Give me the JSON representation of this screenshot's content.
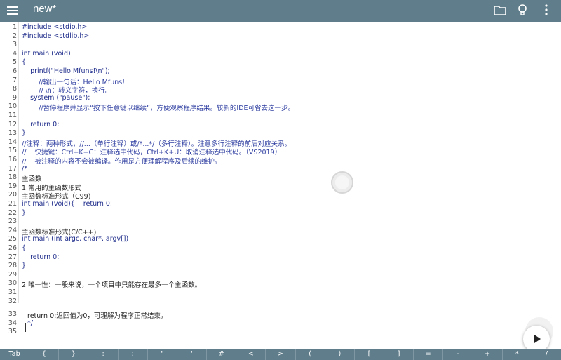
{
  "appbar": {
    "title": "new*",
    "icons": [
      "menu-icon",
      "folder-icon",
      "lightbulb-icon",
      "more-vert-icon"
    ]
  },
  "editor": {
    "line_numbers": [
      "1",
      "2",
      "3",
      "4",
      "5",
      "6",
      "7",
      "8",
      "9",
      "10",
      "11",
      "12",
      "13",
      "14",
      "15",
      "16",
      "17",
      "18",
      "19",
      "20",
      "21",
      "22",
      "23",
      "24",
      "25",
      "26",
      "27",
      "28",
      "29",
      "30",
      "31",
      "32",
      "33",
      "34",
      "35"
    ],
    "lines": [
      "#include <stdio.h>",
      "#include <stdlib.h>",
      "",
      "int main (void)",
      "{",
      "    printf(\"Hello Mfuns!\\n\");",
      "        //输出一句话：Hello Mfuns!",
      "        // \\n：转义字符，换行。",
      "    system (\"pause\");",
      "        //暂停程序并显示“按下任意键以继续”，方便观察程序结果。较新的IDE可省去这一步。",
      "",
      "    return 0;",
      "}",
      "//注释：两种形式，//...（单行注释）或/*...*/（多行注释）。注意多行注释的前后对应关系。",
      "//    快捷键：Ctrl+K+C：注释选中代码，Ctrl+K+U：取消注释选中代码。（VS2019）",
      "//    被注释的内容不会被编译。作用是方便理解程序及后续的维护。",
      "/*",
      "主函数",
      "1.常用的主函数形式",
      "主函数标准形式（C99)",
      "int main (void){    return 0;",
      "}",
      "",
      "主函数标准形式(C/C++)",
      "int main (int argc, char*, argv[])",
      "{",
      "    return 0;",
      "}",
      "",
      "2.唯一性：一般来说，一个项目中只能存在最多一个主函数。",
      "",
      "",
      " return 0:返回值为0，可理解为程序正常结束。",
      " */",
      ""
    ]
  },
  "keybar": {
    "keys": [
      "Tab",
      "{",
      "}",
      ":",
      ";",
      "\"",
      "'",
      "#",
      "<",
      ">",
      "(",
      ")",
      "[",
      "]",
      "=",
      "-",
      "+",
      "*",
      "/"
    ]
  },
  "fab": {
    "icon": "play-icon"
  },
  "colors": {
    "appbar": "#5f7d8b",
    "code": "#1d2b8a",
    "background": "#ffffff"
  }
}
